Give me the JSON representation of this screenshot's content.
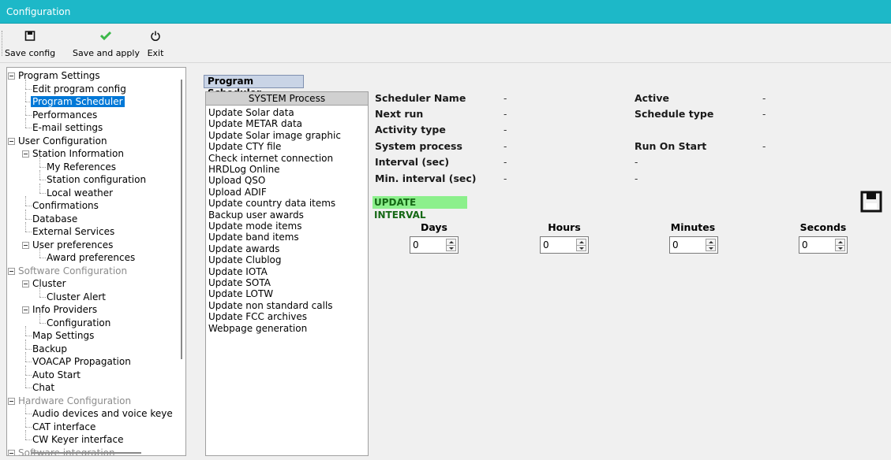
{
  "window": {
    "title": "Configuration"
  },
  "toolbar": {
    "save_config": "Save config",
    "save_apply": "Save and apply",
    "exit": "Exit"
  },
  "tree": [
    {
      "label": "Program Settings",
      "level": 0,
      "expanded": true
    },
    {
      "label": "Edit program config",
      "level": 1
    },
    {
      "label": "Program Scheduler",
      "level": 1,
      "selected": true
    },
    {
      "label": "Performances",
      "level": 1
    },
    {
      "label": "E-mail settings",
      "level": 1
    },
    {
      "label": "User Configuration",
      "level": 0,
      "expanded": true
    },
    {
      "label": "Station Information",
      "level": 1,
      "expanded": true
    },
    {
      "label": "My References",
      "level": 2
    },
    {
      "label": "Station configuration",
      "level": 2
    },
    {
      "label": "Local weather",
      "level": 2
    },
    {
      "label": "Confirmations",
      "level": 1
    },
    {
      "label": "Database",
      "level": 1
    },
    {
      "label": "External Services",
      "level": 1
    },
    {
      "label": "User preferences",
      "level": 1,
      "expanded": true
    },
    {
      "label": "Award preferences",
      "level": 2
    },
    {
      "label": "Software Configuration",
      "level": 0,
      "expanded": true,
      "disabled": true
    },
    {
      "label": "Cluster",
      "level": 1,
      "expanded": true
    },
    {
      "label": "Cluster Alert",
      "level": 2
    },
    {
      "label": "Info Providers",
      "level": 1,
      "expanded": true
    },
    {
      "label": "Configuration",
      "level": 2
    },
    {
      "label": "Map Settings",
      "level": 1
    },
    {
      "label": "Backup",
      "level": 1
    },
    {
      "label": "VOACAP Propagation",
      "level": 1
    },
    {
      "label": "Auto Start",
      "level": 1
    },
    {
      "label": "Chat",
      "level": 1
    },
    {
      "label": "Hardware Configuration",
      "level": 0,
      "expanded": true,
      "disabled": true
    },
    {
      "label": "Audio devices and voice keye",
      "level": 1
    },
    {
      "label": "CAT interface",
      "level": 1
    },
    {
      "label": "CW Keyer interface",
      "level": 1
    },
    {
      "label": "Software integration",
      "level": 0,
      "expanded": true,
      "disabled": true
    }
  ],
  "scheduler": {
    "section_title": "Program Scheduler",
    "list_header": "SYSTEM Process",
    "processes": [
      "Update Solar data",
      "Update METAR data",
      "Update Solar image graphic",
      "Update CTY file",
      "Check internet connection",
      "HRDLog Online",
      "Upload QSO",
      "Upload ADIF",
      "Update country data items",
      "Backup user awards",
      "Update mode items",
      "Update band items",
      "Update awards",
      "Update Clublog",
      "Update IOTA",
      "Update SOTA",
      "Update LOTW",
      "Update non standard calls",
      "Update FCC archives",
      "Webpage generation"
    ]
  },
  "details": {
    "scheduler_name": {
      "label": "Scheduler Name",
      "value": "-"
    },
    "next_run": {
      "label": "Next run",
      "value": "-"
    },
    "activity_type": {
      "label": "Activity type",
      "value": "-"
    },
    "system_process": {
      "label": "System process",
      "value": "-"
    },
    "interval": {
      "label": "Interval (sec)",
      "value": "-"
    },
    "min_interval": {
      "label": "Min. interval (sec)",
      "value": "-"
    },
    "active": {
      "label": "Active",
      "value": "-"
    },
    "schedule_type": {
      "label": "Schedule type",
      "value": "-"
    },
    "run_on_start": {
      "label": "Run On Start",
      "value": "-"
    },
    "extra1": "-",
    "extra2": "-"
  },
  "update_interval": {
    "title": "UPDATE INTERVAL",
    "days": {
      "label": "Days",
      "value": "0"
    },
    "hours": {
      "label": "Hours",
      "value": "0"
    },
    "minutes": {
      "label": "Minutes",
      "value": "0"
    },
    "seconds": {
      "label": "Seconds",
      "value": "0"
    }
  }
}
